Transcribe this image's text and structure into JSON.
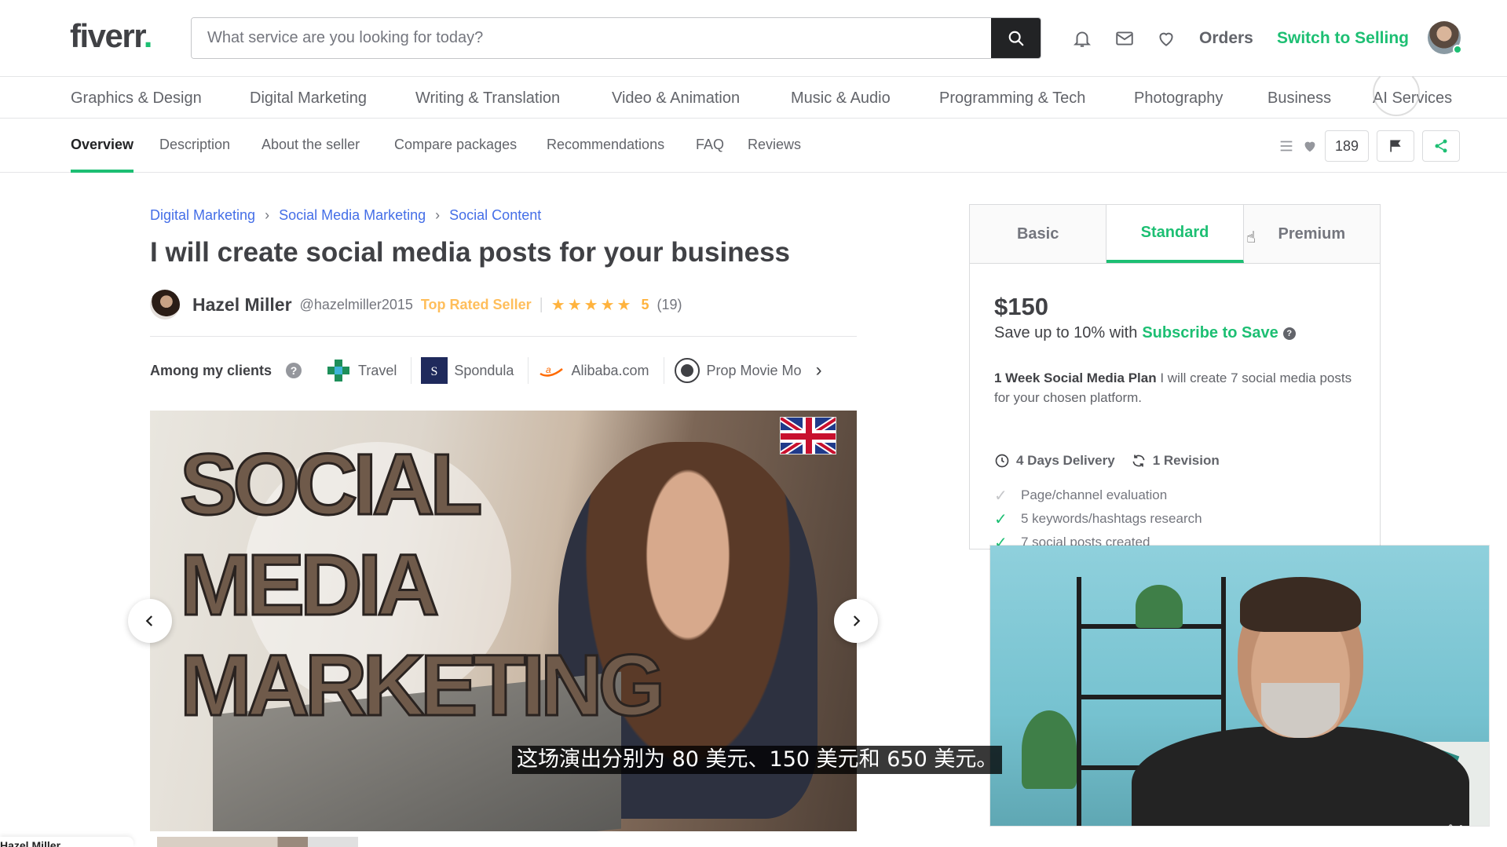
{
  "header": {
    "logo_text": "fiverr",
    "logo_dot": ".",
    "search_placeholder": "What service are you looking for today?",
    "icons": [
      "bell-icon",
      "mail-icon",
      "heart-icon"
    ],
    "orders_label": "Orders",
    "switch_label": "Switch to Selling"
  },
  "categories": [
    "Graphics & Design",
    "Digital Marketing",
    "Writing & Translation",
    "Video & Animation",
    "Music & Audio",
    "Programming & Tech",
    "Photography",
    "Business",
    "AI Services"
  ],
  "subnav": {
    "tabs": [
      "Overview",
      "Description",
      "About the seller",
      "Compare packages",
      "Recommendations",
      "FAQ",
      "Reviews"
    ],
    "active_tab": "Overview",
    "likes_count": "189"
  },
  "gig": {
    "breadcrumbs": [
      "Digital Marketing",
      "Social Media Marketing",
      "Social Content"
    ],
    "title": "I will create social media posts for your business",
    "seller_name": "Hazel Miller",
    "seller_handle": "@hazelmiller2015",
    "seller_level": "Top Rated Seller",
    "rating": "5",
    "review_count": "(19)",
    "clients_label": "Among my clients",
    "clients": [
      "Travel",
      "Spondula",
      "Alibaba.com",
      "Prop Movie Mo"
    ],
    "gallery_text": [
      "SOCIAL",
      "MEDIA",
      "MARKETING"
    ],
    "bottom_name": "Hazel Miller"
  },
  "package": {
    "tabs": [
      "Basic",
      "Standard",
      "Premium"
    ],
    "active_tab": "Standard",
    "price": "$150",
    "save_prefix": "Save up to 10% with",
    "save_link": "Subscribe to Save",
    "plan_name": "1 Week Social Media Plan",
    "plan_desc": "I will create 7 social media posts for your chosen platform.",
    "delivery": "4 Days Delivery",
    "revisions": "1 Revision",
    "features": [
      {
        "text": "Page/channel evaluation",
        "included": false
      },
      {
        "text": "5 keywords/hashtags research",
        "included": true
      },
      {
        "text": "7 social posts created",
        "included": true
      }
    ]
  },
  "overlay": {
    "subtitle": "这场演出分别为 80 美元、150 美元和 650 美元。",
    "watermark": "ûdemy"
  },
  "colors": {
    "brand_green": "#1dbf73",
    "link_blue": "#446ee7",
    "star_gold": "#ffb33e",
    "text_dark": "#404145"
  }
}
